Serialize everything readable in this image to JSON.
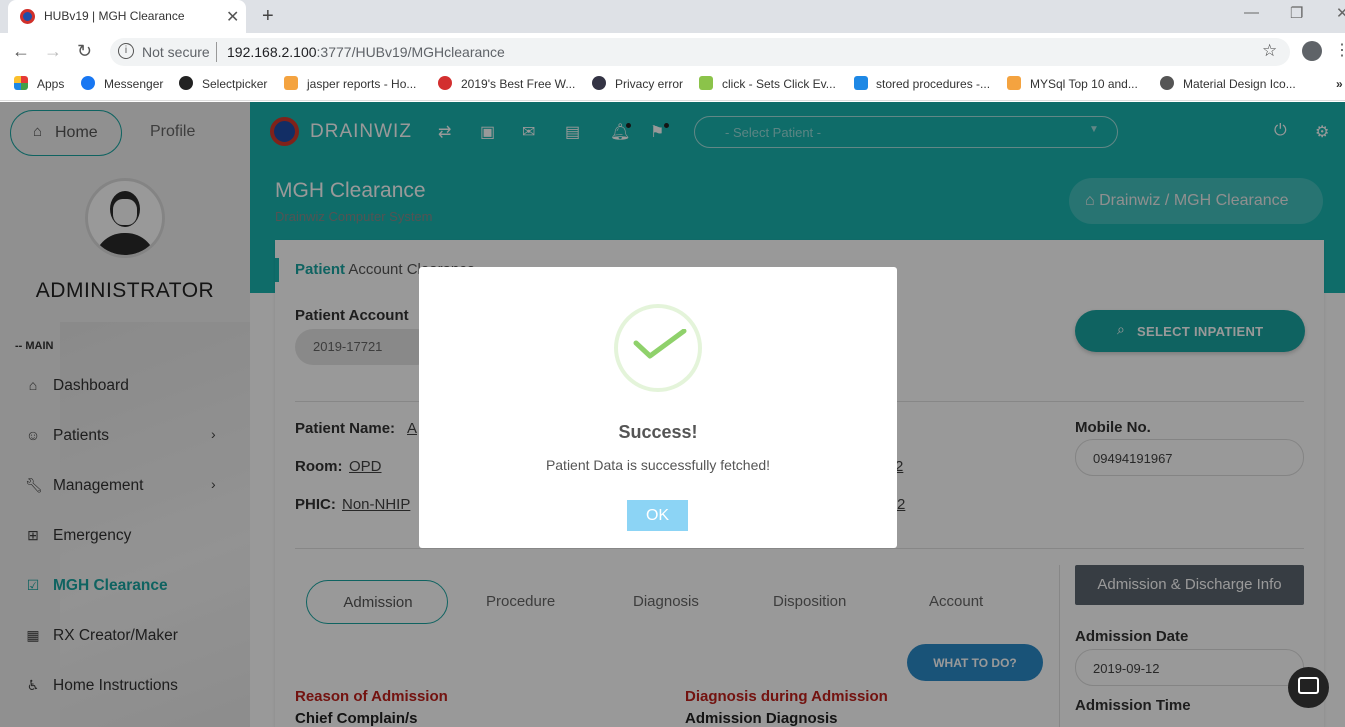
{
  "browser": {
    "tab_title": "HUBv19 | MGH Clearance",
    "security": "Not secure",
    "url_host": "192.168.2.100",
    "url_rest": ":3777/HUBv19/MGHclearance",
    "bookmarks": [
      "Apps",
      "Messenger",
      "Selectpicker",
      "jasper reports - Ho...",
      "2019's Best Free W...",
      "Privacy error",
      "click - Sets Click Ev...",
      "stored procedures -...",
      "MYSql Top 10 and...",
      "Material Design Ico..."
    ],
    "bookmarks_more": "»"
  },
  "sidebar": {
    "home_label": "Home",
    "profile_label": "Profile",
    "user_name": "ADMINISTRATOR",
    "section_label": "-- MAIN",
    "items": [
      {
        "label": "Dashboard"
      },
      {
        "label": "Patients"
      },
      {
        "label": "Management"
      },
      {
        "label": "Emergency"
      },
      {
        "label": "MGH Clearance"
      },
      {
        "label": "RX Creator/Maker"
      },
      {
        "label": "Home Instructions"
      }
    ]
  },
  "topbar": {
    "brand": "DRAINWIZ",
    "select_placeholder": "- Select Patient -"
  },
  "page": {
    "title": "MGH Clearance",
    "subtitle": "Drainwiz Computer System",
    "breadcrumb_home": "Drainwiz",
    "breadcrumb_sep": "/",
    "breadcrumb_current": "MGH Clearance"
  },
  "card": {
    "title_strong": "Patient",
    "title_rest": "Account Clearance",
    "patient_account_label": "Patient Account",
    "patient_account_value": "2019-17721",
    "select_inpatient": "SELECT INPATIENT",
    "patient_name_label": "Patient Name:",
    "patient_name_value": "A",
    "room_label": "Room:",
    "room_value": "OPD",
    "phic_label": "PHIC:",
    "phic_value": "Non-NHIP",
    "partial_1": "2",
    "partial_2": "2",
    "mobile_label": "Mobile No.",
    "mobile_value": "09494191967",
    "tabs": [
      "Admission",
      "Procedure",
      "Diagnosis",
      "Disposition",
      "Account"
    ],
    "admission_info_btn": "Admission & Discharge Info",
    "what_to_do": "WHAT TO DO?",
    "reason_heading": "Reason of Admission",
    "chief_complain": "Chief Complain/s",
    "diag_heading": "Diagnosis during Admission",
    "admission_diagnosis": "Admission Diagnosis",
    "admission_date_label": "Admission Date",
    "admission_date_value": "2019-09-12",
    "admission_time_label": "Admission Time"
  },
  "modal": {
    "title": "Success!",
    "message": "Patient Data is successfully fetched!",
    "ok": "OK"
  }
}
